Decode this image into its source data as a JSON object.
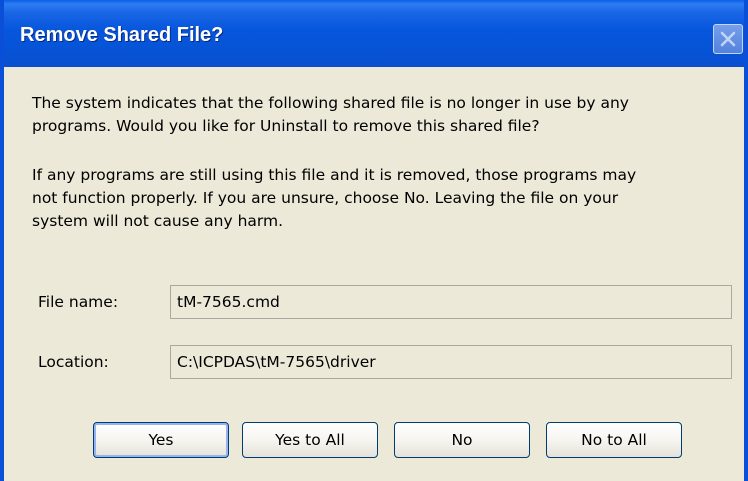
{
  "window": {
    "title": "Remove Shared File?"
  },
  "message": {
    "paragraph1_line1": "The system indicates that the following shared file is no longer in use by any",
    "paragraph1_line2": "programs. Would you like for Uninstall to remove this shared file?",
    "paragraph2_line1": "If any programs are still using this file and it is removed, those programs may",
    "paragraph2_line2": "not function properly. If you are unsure, choose No. Leaving the file on your",
    "paragraph2_line3": "system will not cause any harm."
  },
  "fields": {
    "file_name_label": "File name:",
    "file_name_value": "tM-7565.cmd",
    "location_label": "Location:",
    "location_value": "C:\\ICPDAS\\tM-7565\\driver"
  },
  "buttons": {
    "yes": "Yes",
    "yes_to_all": "Yes to All",
    "no": "No",
    "no_to_all": "No to All"
  },
  "colors": {
    "titlebar": "#0656dc",
    "dialog_bg": "#ece9d8",
    "button_border": "#003c74"
  },
  "icons": {
    "close": "close-icon"
  }
}
